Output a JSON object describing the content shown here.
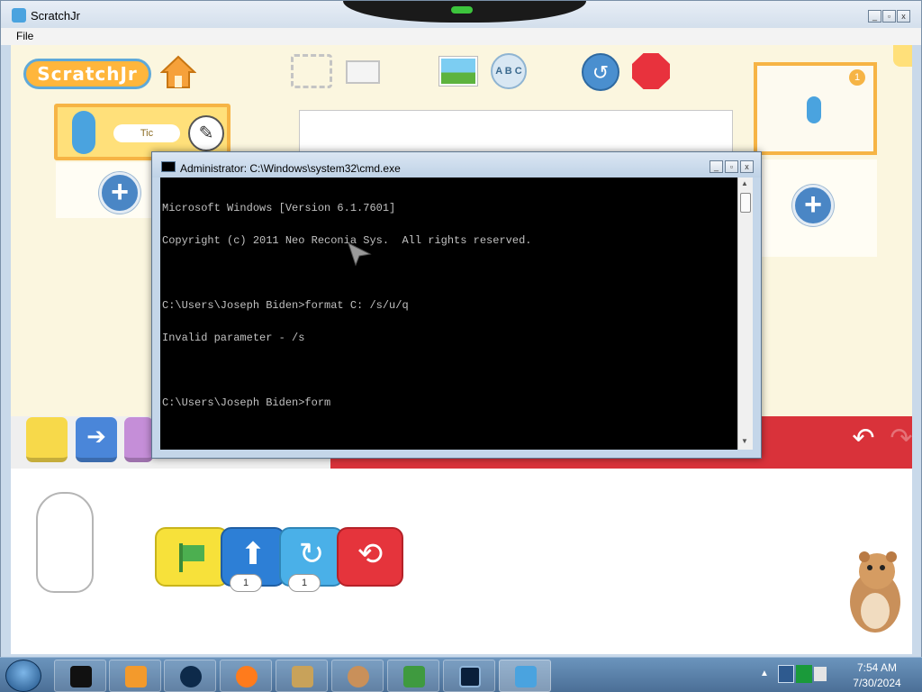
{
  "scratch_window": {
    "title": "ScratchJr",
    "menu_file": "File",
    "logo_text": "ScratchJr",
    "sprite_name": "Tic",
    "page_number": "1",
    "text_icon_label": "A B C",
    "block_counts": [
      "1",
      "1"
    ]
  },
  "cmd_window": {
    "title": "Administrator: C:\\Windows\\system32\\cmd.exe",
    "lines": [
      "Microsoft Windows [Version 6.1.7601]",
      "Copyright (c) 2011 Neo Reconia Sys.  All rights reserved.",
      "",
      "C:\\Users\\Joseph Biden>format C: /s/u/q",
      "Invalid parameter - /s",
      "",
      "C:\\Users\\Joseph Biden>form"
    ]
  },
  "taskbar": {
    "time": "7:54 AM",
    "date": "7/30/2024",
    "items": [
      "terminal-app",
      "media-player",
      "globe-app",
      "firefox",
      "box-app",
      "hamster-app",
      "checklist-app",
      "cmd-app",
      "scratchjr-app"
    ]
  },
  "colors": {
    "scratch_bg": "#fbf6df",
    "accent_orange": "#f6b445",
    "palette_red": "#d9323a",
    "cmd_bg": "#000000",
    "taskbar": "#5a82aa"
  }
}
